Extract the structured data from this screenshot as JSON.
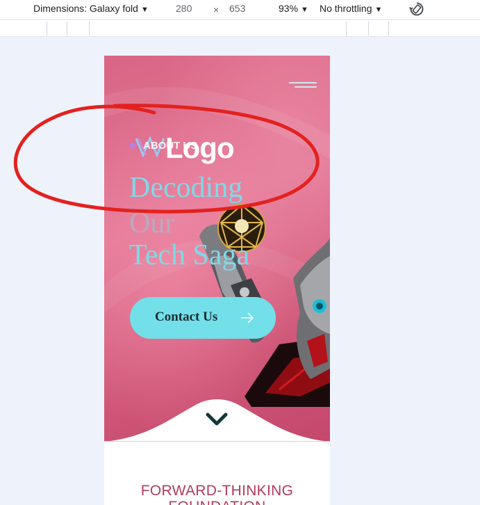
{
  "devtools": {
    "dimensions_label": "Dimensions: Galaxy fold",
    "width": "280",
    "times": "×",
    "height": "653",
    "zoom": "93%",
    "throttling": "No throttling",
    "icons": {
      "rotate": "rotate-icon",
      "caret": "caret-down-icon"
    }
  },
  "site": {
    "logo_text": "Logo",
    "overlay_text": "ABOUT US",
    "headline": [
      "Decoding",
      "Our",
      "Tech Saga"
    ],
    "contact_button": "Contact Us",
    "section_title": [
      "FORWARD-THINKING",
      "FOUNDATION"
    ],
    "colors": {
      "hero_pink": "#e27795",
      "accent_cyan": "#72dfe9",
      "heading_cyan": "#7fd9e8",
      "section_title": "#b23a5e",
      "annotation_red": "#e3211f"
    },
    "icons": {
      "menu": "hamburger-menu-icon",
      "arrow": "arrow-right-icon",
      "scroll": "chevron-down-icon",
      "logo": "logo-mark-icon"
    }
  }
}
